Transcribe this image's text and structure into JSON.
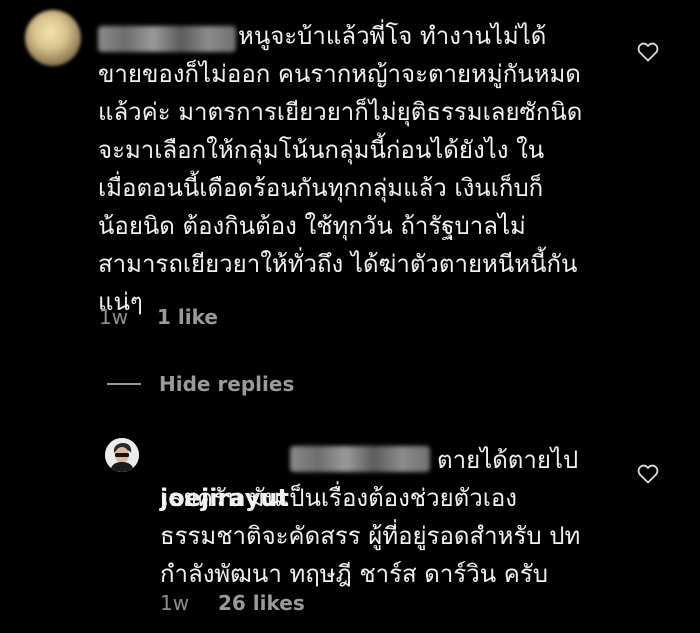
{
  "comment": {
    "text_after_name": "หนูจะบ้าแล้วพี่โจ ทำงานไม่ได้",
    "text_lines": "ขายของก็ไม่ออก คนรากหญ้าจะตายหมู่กันหมด\nแล้วค่ะ มาตรการเยียวยาก็ไม่ยุติธรรมเลยซักนิด\nจะมาเลือกให้กลุ่มโน้นกลุ่มนี้ก่อนได้ยังไง ใน\nเมื่อตอนนี้เดือดร้อนกันทุกกลุ่มแล้ว เงินเก็บก็\nน้อยนิด ต้องกินต้อง ใช้ทุกวัน ถ้ารัฐบาลไม่\nสามารถเยียวยาให้ทั่วถึง ได้ฆ่าตัวตายหนีหนี้กัน\nแน่ๆ",
    "time": "1w",
    "likes": "1 like"
  },
  "hide_replies_label": "Hide replies",
  "reply": {
    "username": "joejirayut",
    "text_after_name": "ตายได้ตายไป",
    "text_lines": "เลยครับ มันเป็นเรื่องต้องช่วยตัวเอง\nธรรมชาติจะคัดสรร ผู้ที่อยู่รอดสำหรับ ปท\nกำลังพัฒนา  ทฤษฎี ชาร์ส ดาร์วิน ครับ",
    "time": "1w",
    "likes": "26 likes"
  },
  "icons": {
    "like": "heart-outline-icon"
  },
  "colors": {
    "background": "#000000",
    "text": "#f1f1f1",
    "secondary": "#8e8e8e"
  }
}
